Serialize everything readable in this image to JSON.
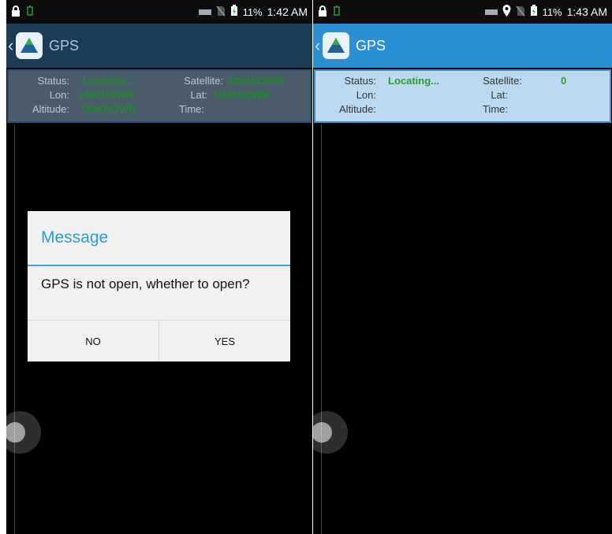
{
  "left": {
    "statusbar": {
      "battery": "11%",
      "time": "1:42 AM"
    },
    "appbar": {
      "title": "GPS"
    },
    "info": {
      "status_label": "Status:",
      "status_value": "Locating...",
      "satellite_label": "Satellite:",
      "satellite_value": "UNKNOWN",
      "lon_label": "Lon:",
      "lon_value": "UNKNOWN",
      "lat_label": "Lat:",
      "lat_value": "UNKNOWN",
      "altitude_label": "Altitude:",
      "altitude_value": "UNKNOWN",
      "time_label": "Time:",
      "time_value": ""
    },
    "dialog": {
      "title": "Message",
      "message": "GPS is not open, whether to open?",
      "no_label": "NO",
      "yes_label": "YES"
    }
  },
  "right": {
    "statusbar": {
      "battery": "11%",
      "time": "1:43 AM"
    },
    "appbar": {
      "title": "GPS"
    },
    "info": {
      "status_label": "Status:",
      "status_value": "Locating...",
      "satellite_label": "Satellite:",
      "satellite_value": "0",
      "lon_label": "Lon:",
      "lon_value": "",
      "lat_label": "Lat:",
      "lat_value": "",
      "altitude_label": "Altitude:",
      "altitude_value": "",
      "time_label": "Time:",
      "time_value": ""
    }
  },
  "colors": {
    "appbar_active": "#2b8fd6",
    "appbar_dimmed": "#1c3b56",
    "value_green": "#2e9b2e",
    "dialog_accent": "#2a9fd6"
  },
  "icons": [
    "lock-icon",
    "battery-small-icon",
    "keyboard-icon",
    "no-sim-icon",
    "battery-charging-icon",
    "location-pin-icon",
    "gps-app-icon",
    "chevron-left-icon"
  ]
}
